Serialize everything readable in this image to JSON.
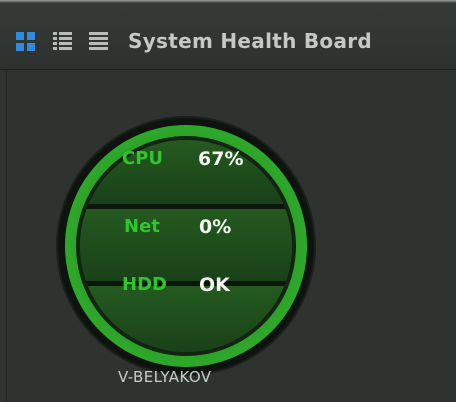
{
  "toolbar": {
    "view_buttons": [
      {
        "icon": "grid-view-icon",
        "active": true,
        "color": "#2e8ce0"
      },
      {
        "icon": "list-view-icon",
        "active": false,
        "color": "#b8bcb8"
      },
      {
        "icon": "detail-view-icon",
        "active": false,
        "color": "#b8bcb8"
      }
    ]
  },
  "header": {
    "title": "System Health Board"
  },
  "host": {
    "name": "V-BELYAKOV",
    "status_color": "#2ea82a",
    "metrics": {
      "cpu": {
        "label": "CPU",
        "value": "67%"
      },
      "net": {
        "label": "Net",
        "value": "0%"
      },
      "hdd": {
        "label": "HDD",
        "value": "OK"
      }
    }
  }
}
